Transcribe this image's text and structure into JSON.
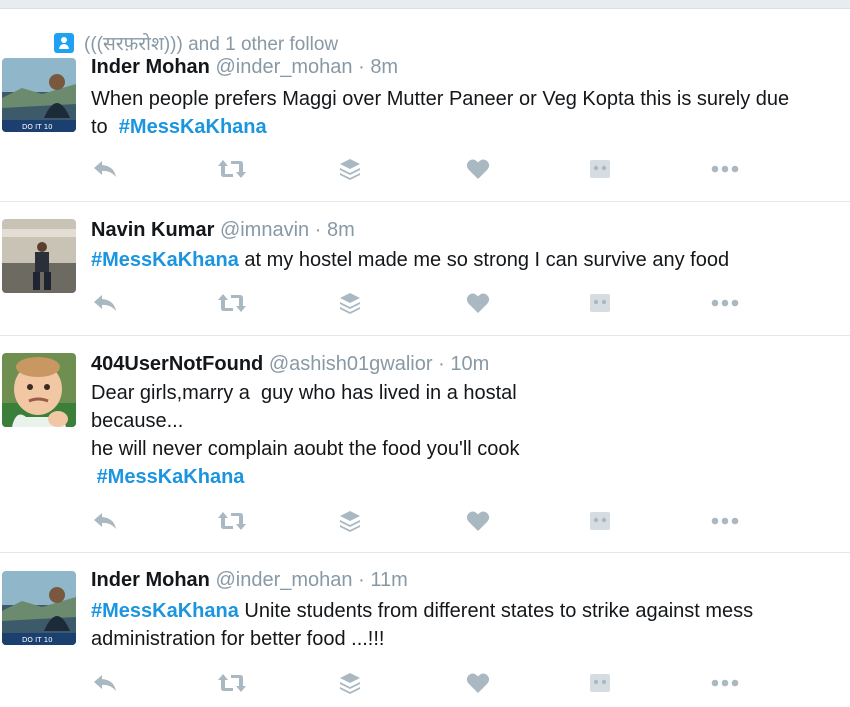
{
  "social_context": {
    "text": "(((सरफ़रोश))) and 1 other follow",
    "icon": "follow-person-icon"
  },
  "tweets": [
    {
      "name": "Inder Mohan",
      "handle": "@inder_mohan",
      "sep": "·",
      "time": "8m",
      "lines": [
        {
          "text": "When people prefers Maggi over Mutter Paneer or Veg Kopta this is surely due"
        },
        {
          "prefix": "to  ",
          "hashtag": "#MessKaKhana"
        }
      ],
      "avatar_caption": "DO IT 10"
    },
    {
      "name": "Navin Kumar",
      "handle": "@imnavin",
      "sep": "·",
      "time": "8m",
      "lines": [
        {
          "hashtag": "#MessKaKhana",
          "suffix": " at my hostel made me so strong I can survive any food"
        }
      ]
    },
    {
      "name": "404UserNotFound",
      "handle": "@ashish01gwalior",
      "sep": "·",
      "time": "10m",
      "lines": [
        {
          "text": "Dear girls,marry a  guy who has lived in a hostal"
        },
        {
          "text": "because..."
        },
        {
          "text": "he will never complain aoubt the food you'll cook"
        },
        {
          "prefix": " ",
          "hashtag": "#MessKaKhana"
        }
      ]
    },
    {
      "name": "Inder Mohan",
      "handle": "@inder_mohan",
      "sep": "·",
      "time": "11m",
      "lines": [
        {
          "hashtag": "#MessKaKhana",
          "suffix": " Unite students from different states to strike against mess"
        },
        {
          "text": "administration for better food ...!!!"
        }
      ],
      "avatar_caption": "DO IT 10"
    }
  ],
  "action_icons": [
    "reply-icon",
    "retweet-icon",
    "stack-icon",
    "like-icon",
    "dm-icon",
    "more-icon"
  ],
  "colors": {
    "accent": "#1b95e0",
    "muted": "#8899a6",
    "icon": "#aab8c2",
    "divider": "#e1e8ed"
  }
}
